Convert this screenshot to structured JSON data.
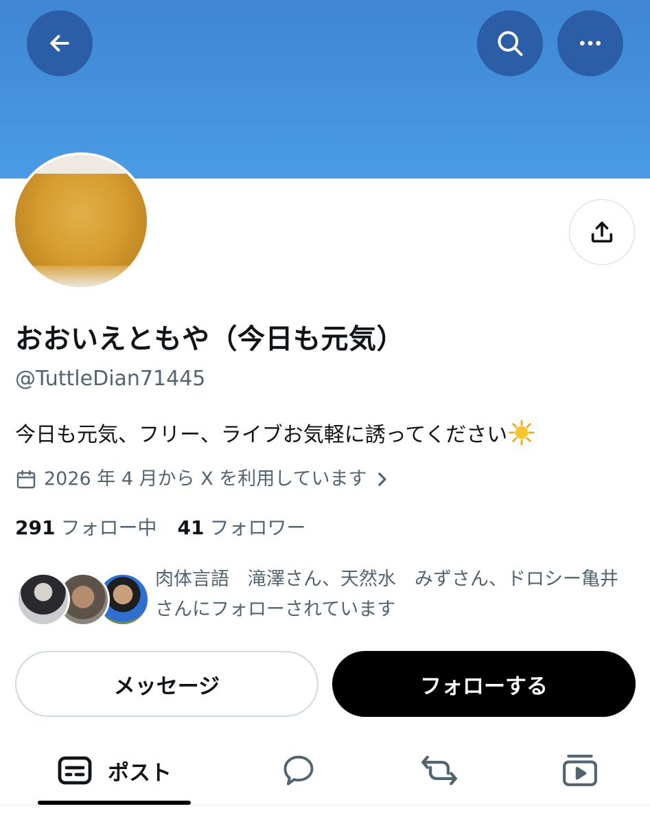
{
  "header": {
    "back_icon": "arrow-left-icon",
    "search_icon": "search-icon",
    "more_icon": "more-horizontal-icon",
    "banner_color": "#4a9be6",
    "button_color": "#2b5ea7"
  },
  "profile": {
    "display_name": "おおいえともや（今日も元気）",
    "handle": "@TuttleDian71445",
    "bio": "今日も元気、フリー、ライブお気軽に誘ってください",
    "bio_emoji": "sun-emoji",
    "joined": "2026 年 4 月から X を利用しています",
    "share_icon": "share-icon"
  },
  "stats": {
    "following_count": "291",
    "following_label": "フォロー中",
    "followers_count": "41",
    "followers_label": "フォロワー"
  },
  "followed_by": {
    "text": "肉体言語　滝澤さん、天然水　みずさん、ドロシー亀井さんにフォローされています"
  },
  "actions": {
    "message_label": "メッセージ",
    "follow_label": "フォローする"
  },
  "tabs": [
    {
      "label": "ポスト",
      "icon": "posts-icon",
      "active": true
    },
    {
      "label": "",
      "icon": "replies-icon",
      "active": false
    },
    {
      "label": "",
      "icon": "reposts-icon",
      "active": false
    },
    {
      "label": "",
      "icon": "media-icon",
      "active": false
    }
  ]
}
